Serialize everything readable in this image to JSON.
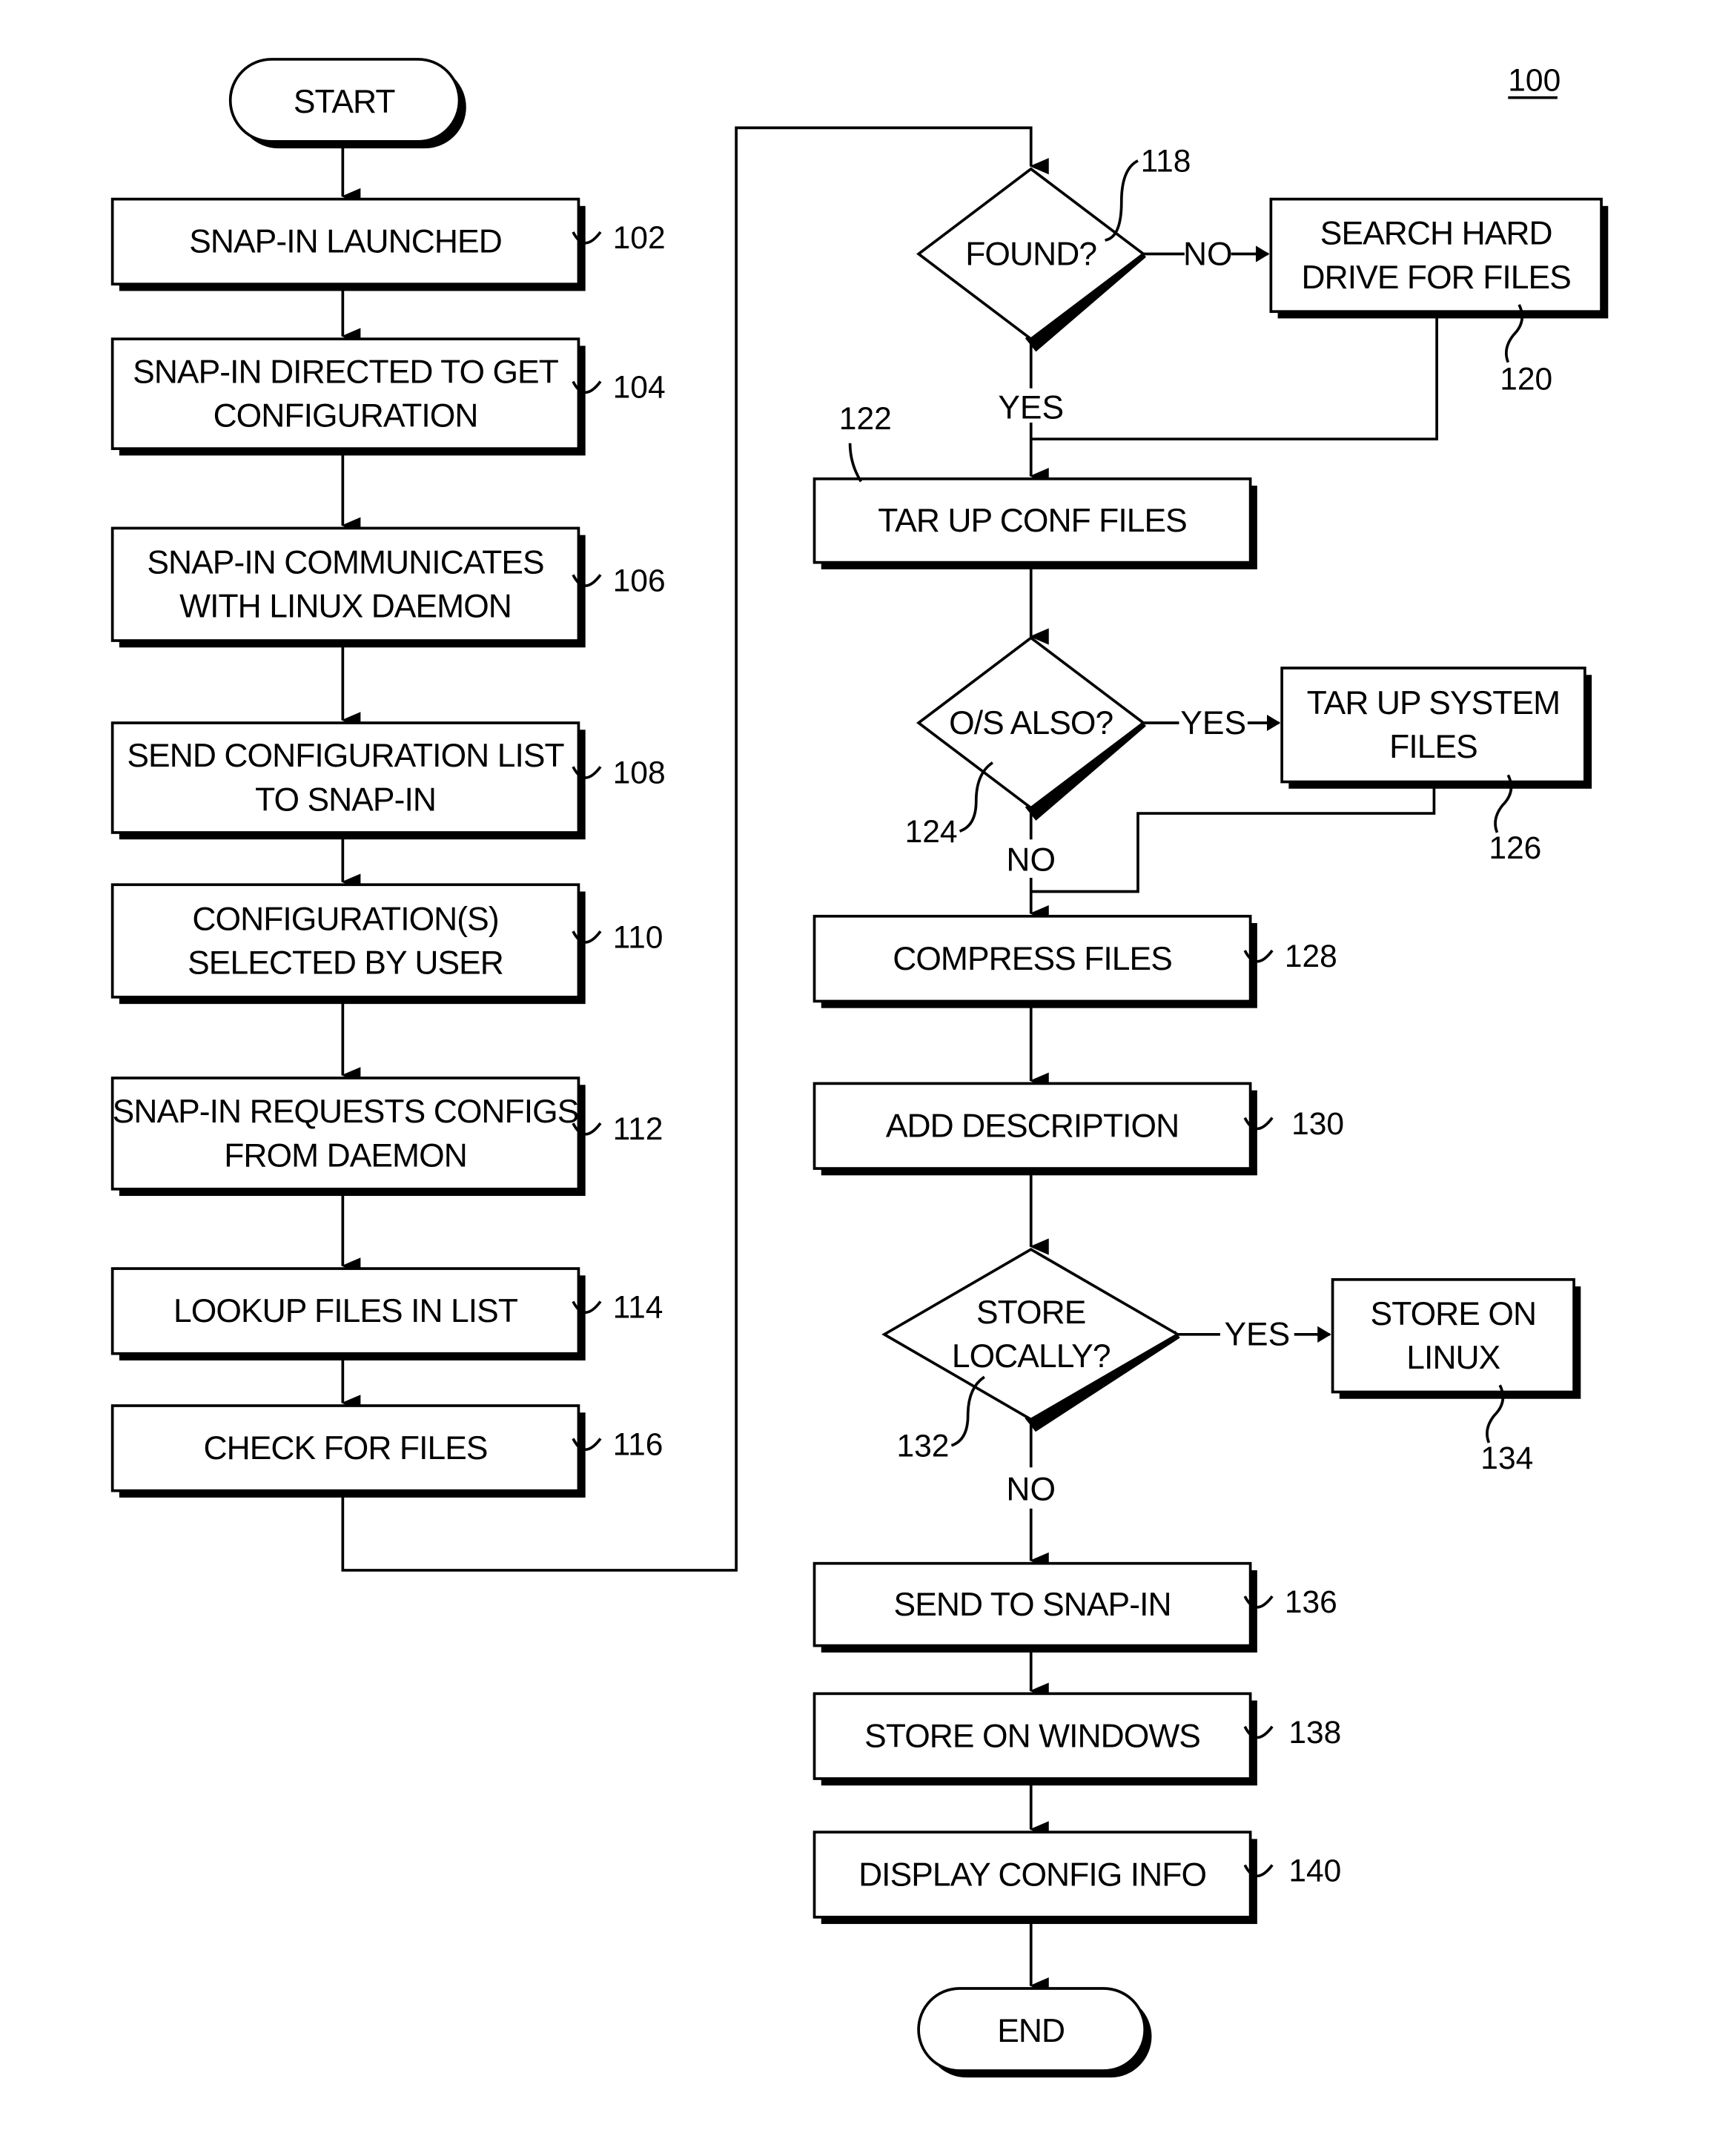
{
  "figure_number": "100",
  "terminals": {
    "start": "START",
    "end": "END"
  },
  "steps": [
    {
      "id": "102",
      "lines": [
        "SNAP-IN LAUNCHED"
      ]
    },
    {
      "id": "104",
      "lines": [
        "SNAP-IN DIRECTED TO GET",
        "CONFIGURATION"
      ]
    },
    {
      "id": "106",
      "lines": [
        "SNAP-IN COMMUNICATES",
        "WITH LINUX DAEMON"
      ]
    },
    {
      "id": "108",
      "lines": [
        "SEND CONFIGURATION LIST",
        "TO SNAP-IN"
      ]
    },
    {
      "id": "110",
      "lines": [
        "CONFIGURATION(S)",
        "SELECTED BY USER"
      ]
    },
    {
      "id": "112",
      "lines": [
        "SNAP-IN REQUESTS CONFIGS",
        "FROM DAEMON"
      ]
    },
    {
      "id": "114",
      "lines": [
        "LOOKUP FILES IN LIST"
      ]
    },
    {
      "id": "116",
      "lines": [
        "CHECK FOR FILES"
      ]
    },
    {
      "id": "120",
      "lines": [
        "SEARCH HARD",
        "DRIVE FOR FILES"
      ]
    },
    {
      "id": "122",
      "lines": [
        "TAR UP CONF FILES"
      ]
    },
    {
      "id": "126",
      "lines": [
        "TAR UP SYSTEM",
        "FILES"
      ]
    },
    {
      "id": "128",
      "lines": [
        "COMPRESS FILES"
      ]
    },
    {
      "id": "130",
      "lines": [
        "ADD DESCRIPTION"
      ]
    },
    {
      "id": "134",
      "lines": [
        "STORE ON",
        "LINUX"
      ]
    },
    {
      "id": "136",
      "lines": [
        "SEND TO SNAP-IN"
      ]
    },
    {
      "id": "138",
      "lines": [
        "STORE ON WINDOWS"
      ]
    },
    {
      "id": "140",
      "lines": [
        "DISPLAY CONFIG INFO"
      ]
    }
  ],
  "decisions": [
    {
      "id": "118",
      "lines": [
        "FOUND?"
      ],
      "yes": "YES",
      "no": "NO"
    },
    {
      "id": "124",
      "lines": [
        "O/S ALSO?"
      ],
      "yes": "YES",
      "no": "NO"
    },
    {
      "id": "132",
      "lines": [
        "STORE",
        "LOCALLY?"
      ],
      "yes": "YES",
      "no": "NO"
    }
  ]
}
